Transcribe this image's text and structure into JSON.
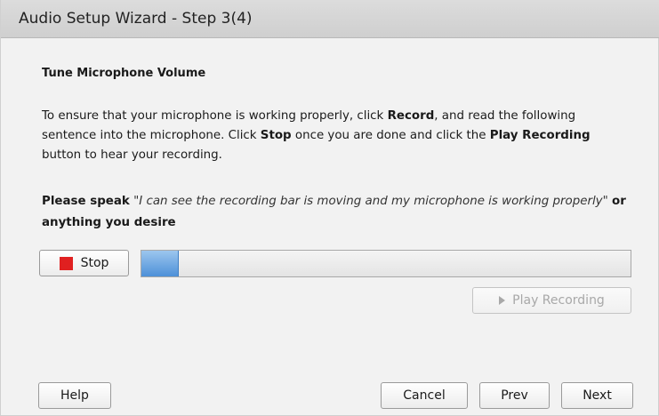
{
  "window": {
    "title": "Audio Setup Wizard - Step 3(4)"
  },
  "content": {
    "heading": "Tune Microphone Volume",
    "instructions": {
      "p1": "To ensure that your microphone is working properly, click ",
      "record": "Record",
      "p2": ", and read the following sentence into the microphone. Click ",
      "stop": "Stop",
      "p3": " once you are done and click the ",
      "play_recording": "Play Recording",
      "p4": " button to hear your recording."
    },
    "speak": {
      "lead": "Please speak",
      "quote": "\"I can see the recording bar is moving and my microphone is working properly\"",
      "tail": "or anything you desire"
    }
  },
  "controls": {
    "stop_label": "Stop",
    "stop_icon": "stop-square-icon",
    "stop_icon_color": "#e02020",
    "level_meter_percent": 7.5,
    "meter_fill_color": "#4d90d8",
    "play_label": "Play Recording",
    "play_icon": "play-triangle-icon",
    "play_enabled": false
  },
  "footer": {
    "help_label": "Help",
    "cancel_label": "Cancel",
    "prev_label": "Prev",
    "next_label": "Next"
  }
}
